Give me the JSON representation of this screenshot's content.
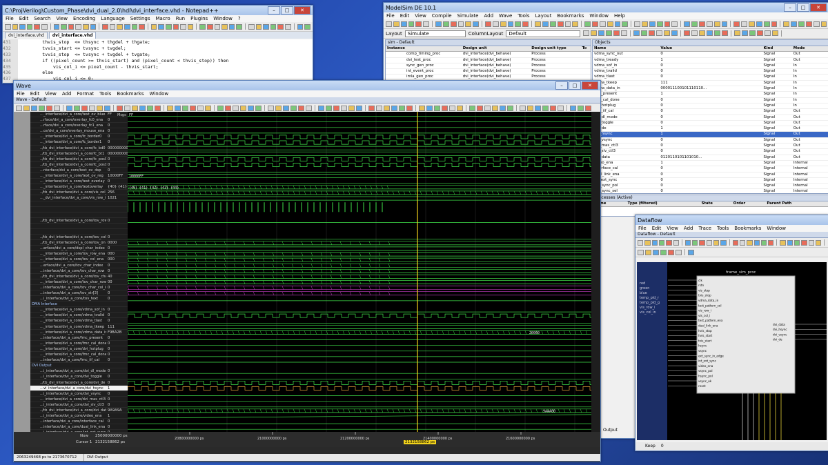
{
  "notepad": {
    "title": "C:\\ProjVerilog\\Custom_Phase\\dvi_dual_2.0\\hdl\\dvi_interface.vhd - Notepad++",
    "menu": [
      "File",
      "Edit",
      "Search",
      "View",
      "Encoding",
      "Language",
      "Settings",
      "Macro",
      "Run",
      "Plugins",
      "Window",
      "?"
    ],
    "tabs": [
      "dvi_interface.vhd"
    ],
    "lines": [
      {
        "n": "431",
        "t": "        thvis_stop  <= thsync + thgdel + thgate;"
      },
      {
        "n": "432",
        "t": "        tvvis_start <= tvsync + tvgdel;"
      },
      {
        "n": "433",
        "t": "        tvvis_stop  <= tvsync + tvgdel + tvgate;"
      },
      {
        "n": "434",
        "t": "        if ((pixel_count >= thvis_start) and (pixel_count < thvis_stop)) then"
      },
      {
        "n": "435",
        "t": "            vis_col_i <= pixel_count - thvis_start;"
      },
      {
        "n": "436",
        "t": "        else"
      },
      {
        "n": "437",
        "t": "            vis_col_i <= 0;"
      }
    ]
  },
  "wave": {
    "title": "Wave",
    "menu": [
      "File",
      "Edit",
      "View",
      "Add",
      "Format",
      "Tools",
      "Bookmarks",
      "Window"
    ],
    "subtitle": "Wave - Default",
    "msgs_label": "Msgs",
    "signals": [
      {
        "name": "..._interface/dvi_a_core/text_ov_blue",
        "value": "FF"
      },
      {
        "name": "...rface/dvi_a_core/overlay_fc0_ena",
        "value": "0"
      },
      {
        "name": "...rface/dvi_a_core/overlay_fc1_ena",
        "value": "0"
      },
      {
        "name": "...ce/dvi_a_core/overlay_mouse_ena",
        "value": "0"
      },
      {
        "name": "..._interface/dvi_a_core/fc_border0",
        "value": "0"
      },
      {
        "name": "..._interface/dvi_a_core/fc_border1",
        "value": "0"
      },
      {
        "name": "../tb_dvi_interface/dvi_a_core/fc_bd0",
        "value": "000000000000"
      },
      {
        "name": "../tb_dvi_interface/dvi_a_core/fc_bt1",
        "value": "000000000000"
      },
      {
        "name": "../tb_dvi_interface/dvi_a_core/fc_pos0",
        "value": "0"
      },
      {
        "name": "../tb_dvi_interface/dvi_a_core/fc_pos1",
        "value": "0"
      },
      {
        "name": "...nterface/dvi_a_core/text_ov_dsp",
        "value": "0"
      },
      {
        "name": "..._interface/dvi_a_core/text_ov_reg",
        "value": "10000FF"
      },
      {
        "name": "..._interface/dvi_a_core/text_overlay",
        "value": "0"
      },
      {
        "name": "..._interface/dvi_a_core/textoverlay",
        "value": "{40} {41} {42} {43}"
      },
      {
        "name": "../tb_dvi_interface/dvi_a_core/vis_col_i",
        "value": "256"
      },
      {
        "name": "..._dvi_interface/dvi_a_core/vis_row_i",
        "value": "1021"
      },
      {
        "name": "",
        "value": ""
      },
      {
        "name": "",
        "value": ""
      },
      {
        "name": "",
        "value": ""
      },
      {
        "name": "../tb_dvi_interface/dvi_a_core/tov_row",
        "value": "0"
      },
      {
        "name": "",
        "value": ""
      },
      {
        "name": "",
        "value": ""
      },
      {
        "name": "../tb_dvi_interface/dvi_a_core/tov_col",
        "value": "0"
      },
      {
        "name": "../tb_dvi_interface/dvi_a_core/tov_on",
        "value": "0000"
      },
      {
        "name": "...erface/dvi_a_core/dspl_char_index",
        "value": "0"
      },
      {
        "name": "..._interface/dvi_a_core/tov_row_ena",
        "value": "000"
      },
      {
        "name": "..._interface/dvi_a_core/tov_col_ena",
        "value": "000"
      },
      {
        "name": "...erface/dvi_a_core/tov_char_index",
        "value": "0"
      },
      {
        "name": "...interface/dvi_a_core/tov_char_row",
        "value": "0"
      },
      {
        "name": "../tb_dvi_interface/dvi_a_core/tov_char",
        "value": "40"
      },
      {
        "name": "..._interface/dvi_a_core/tov_char_row",
        "value": "00"
      },
      {
        "name": "...interface/dvi_a_core/tov_char_col_ind",
        "value": "0"
      },
      {
        "name": "...interface/dvi_a_core/tov_str[3]",
        "value": "0"
      },
      {
        "name": "...i_interface/dvi_a_core/tov_text",
        "value": "0"
      },
      {
        "name": "DMA Interface",
        "value": "",
        "group": true
      },
      {
        "name": "..._interface/dvi_a_core/vdma_sof_in",
        "value": "0"
      },
      {
        "name": "..._interface/dvi_a_core/vdma_tvalid",
        "value": "0"
      },
      {
        "name": "..._interface/dvi_a_core/vdma_tlast",
        "value": "0"
      },
      {
        "name": "..._interface/dvi_a_core/vdma_tkeep",
        "value": "111"
      },
      {
        "name": "..._interface/dvi_a_core/vdma_data_in",
        "value": "F9BA2B"
      },
      {
        "name": "...interface/dvi_a_core/fmc_present",
        "value": "0"
      },
      {
        "name": "..._interface/dvi_a_core/fmc_cal_done",
        "value": "0"
      },
      {
        "name": "..._interface/dvi_a_core/dvi_hotplug",
        "value": "0"
      },
      {
        "name": "..._interface/dvi_a_core/fmc_cal_done",
        "value": "0"
      },
      {
        "name": "...interface/dvi_a_core/fmc_iif_cal",
        "value": "0"
      },
      {
        "name": "DVI Output",
        "value": "",
        "group": true
      },
      {
        "name": "...i_interface/dvi_a_core/dvi_dl_mode",
        "value": "0"
      },
      {
        "name": "...i_interface/dvi_a_core/dvi_toggle",
        "value": "0"
      },
      {
        "name": "../tb_dvi_interface/dvi_a_core/dvi_de",
        "value": "0"
      },
      {
        "name": "...vi_interface/dvi_a_core/dvi_hsync",
        "value": "1",
        "selected": true
      },
      {
        "name": "...i_interface/dvi_a_core/dvi_vsync",
        "value": "0"
      },
      {
        "name": "..._interface/dvi_a_core/dvi_mas_ctl3",
        "value": "0"
      },
      {
        "name": "...i_interface/dvi_a_core/dvi_slv_ctl3",
        "value": "0"
      },
      {
        "name": "../tb_dvi_interface/dvi_a_core/dvi_data",
        "value": "9A9A9A"
      },
      {
        "name": "...i_interface/dvi_a_core/video_ena",
        "value": "1"
      },
      {
        "name": "...interface/dvi_a_core/interface_cal",
        "value": "0"
      },
      {
        "name": "...interface/dvi_a_core/dual_link_ena",
        "value": "0"
      },
      {
        "name": "...i_interface/dvi_a_core/int_ext_sync",
        "value": "0"
      },
      {
        "name": "...interface/dvi_a_core/ext_sync_pol",
        "value": "0"
      }
    ],
    "now_label": "Now",
    "now_value": "25000000000 ps",
    "cursor_label": "Cursor 1",
    "cursor_value": "2132158862 ps",
    "cursor_readout": "2132158862 ps",
    "time_ticks": [
      "20800000000 ps",
      "21000000000 ps",
      "21200000000 ps",
      "21400000000 ps",
      "21600000000 ps"
    ],
    "status_range": "2063249468 ps to 2173670712",
    "status_tab": "DVI Output",
    "hex_fragments": [
      "FF",
      "10000FF",
      "{40} {41} {42} {43} {44}",
      "20000",
      "9AAA80",
      "000000"
    ]
  },
  "modelsim": {
    "title": "ModelSim DE 10.1",
    "menu": [
      "File",
      "Edit",
      "View",
      "Compile",
      "Simulate",
      "Add",
      "Wave",
      "Tools",
      "Layout",
      "Bookmarks",
      "Window",
      "Help"
    ],
    "help_box": "Help",
    "time_input": "100 ps",
    "layout_label": "Layout",
    "layout_value": "Simulate",
    "column_layout_label": "ColumnLayout",
    "column_layout_value": "Default",
    "sim_panel_title": "sim - Default",
    "sim_headers": [
      "Instance",
      "Design unit",
      "Design unit type",
      "To"
    ],
    "sim_rows": [
      {
        "inst": "comp_timing_proc",
        "unit": "dvi_interface(dvi_behave)",
        "type": "Process"
      },
      {
        "inst": "dvi_test_proc",
        "unit": "dvi_interface(dvi_behave)",
        "type": "Process"
      },
      {
        "inst": "sync_gen_proc",
        "unit": "dvi_interface(dvi_behave)",
        "type": "Process"
      },
      {
        "inst": "int_event_proc",
        "unit": "dvi_interface(dvi_behave)",
        "type": "Process"
      },
      {
        "inst": "imla_gen_proc",
        "unit": "dvi_interface(dvi_behave)",
        "type": "Process"
      },
      {
        "inst": "imls_gen_proc",
        "unit": "dvi_interface(dvi_behave)",
        "type": "Process"
      }
    ],
    "objects_title": "Objects",
    "objects_headers": [
      "Name",
      "Value",
      "Kind",
      "Mode"
    ],
    "objects": [
      {
        "name": "vdma_sync_out",
        "value": "0",
        "kind": "Signal",
        "mode": "Out"
      },
      {
        "name": "vdma_tready",
        "value": "1",
        "kind": "Signal",
        "mode": "Out"
      },
      {
        "name": "vdma_sof_in",
        "value": "0",
        "kind": "Signal",
        "mode": "In"
      },
      {
        "name": "vdma_tvalid",
        "value": "0",
        "kind": "Signal",
        "mode": "In"
      },
      {
        "name": "vdma_tlast",
        "value": "0",
        "kind": "Signal",
        "mode": "In"
      },
      {
        "name": "vdma_tkeep",
        "value": "111",
        "kind": "Signal",
        "mode": "In"
      },
      {
        "name": "vdma_data_in",
        "value": "000011100101110110...",
        "kind": "Signal",
        "mode": "In"
      },
      {
        "name": "fmc_present",
        "value": "1",
        "kind": "Signal",
        "mode": "In"
      },
      {
        "name": "fmc_cal_done",
        "value": "0",
        "kind": "Signal",
        "mode": "In"
      },
      {
        "name": "dvi_hotplug",
        "value": "0",
        "kind": "Signal",
        "mode": "In"
      },
      {
        "name": "fmc_iif_cal",
        "value": "0",
        "kind": "Signal",
        "mode": "Out"
      },
      {
        "name": "dvi_dl_mode",
        "value": "0",
        "kind": "Signal",
        "mode": "Out"
      },
      {
        "name": "dvi_toggle",
        "value": "0",
        "kind": "Signal",
        "mode": "Out"
      },
      {
        "name": "dvi_de",
        "value": "1",
        "kind": "Signal",
        "mode": "Out"
      },
      {
        "name": "dvi_hsync",
        "value": "1",
        "kind": "Signal",
        "mode": "Out",
        "selected": true
      },
      {
        "name": "dvi_vsync",
        "value": "0",
        "kind": "Signal",
        "mode": "Out"
      },
      {
        "name": "dvi_mas_ctl3",
        "value": "0",
        "kind": "Signal",
        "mode": "Out"
      },
      {
        "name": "dvi_slv_ctl3",
        "value": "0",
        "kind": "Signal",
        "mode": "Out"
      },
      {
        "name": "dvi_data",
        "value": "0120110101101010...",
        "kind": "Signal",
        "mode": "Out"
      },
      {
        "name": "video_ena",
        "value": "1",
        "kind": "Signal",
        "mode": "Internal"
      },
      {
        "name": "interface_cal",
        "value": "0",
        "kind": "Signal",
        "mode": "Internal"
      },
      {
        "name": "dual_link_ena",
        "value": "0",
        "kind": "Signal",
        "mode": "Internal"
      },
      {
        "name": "int_ext_sync",
        "value": "0",
        "kind": "Signal",
        "mode": "Internal"
      },
      {
        "name": "ext_sync_pol",
        "value": "0",
        "kind": "Signal",
        "mode": "Internal"
      },
      {
        "name": "ext_sync_sel",
        "value": "0",
        "kind": "Signal",
        "mode": "Internal"
      }
    ],
    "processes_title": "Processes (Active)",
    "processes_headers": [
      "Name",
      "Type (filtered)",
      "State",
      "Order",
      "Parent Path"
    ],
    "output_label": "Output"
  },
  "dataflow": {
    "title": "Dataflow",
    "menu": [
      "File",
      "Edit",
      "View",
      "Add",
      "Trace",
      "Tools",
      "Bookmarks",
      "Window"
    ],
    "subtitle": "Dataflow - Default",
    "block_title": "frame_sim_proc",
    "block_ports_in": [
      "clk",
      "rstn",
      "vis_stop",
      "tvis_stop",
      "vdma_data_in",
      "test_pattern_sel",
      "vis_row_i",
      "vis_col_i",
      "test_pattern_ena",
      "dual_link_ena",
      "hvis_stop",
      "hvis_start",
      "tvis_start",
      "hsync",
      "vsync",
      "ext_sync_in_edge",
      "int_ext_sync",
      "video_ena",
      "vsync_pol",
      "hsync_pol",
      "vsync_ok",
      "reset"
    ],
    "block_ports_out": [
      "dvi_data",
      "dvi_hsync",
      "dvi_vsync",
      "dvi_de"
    ],
    "left_values": [
      "red",
      "green",
      "blue",
      "temp_pld_r",
      "temp_pld_g",
      "vis_row_i",
      "vis_col_in"
    ],
    "keep_label": "Keep",
    "keep_value": "0"
  },
  "colors": {
    "wave_bg": "#000000",
    "signal_green": "#3fe34a",
    "cursor_yellow": "#f2d31c",
    "bus_magenta": "#c83fc8",
    "desktop": "#1c3d9c"
  }
}
